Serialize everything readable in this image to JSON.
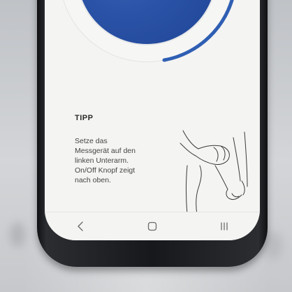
{
  "tip": {
    "title": "TIPP",
    "text": "Setze das\nMessgerät auf den\nlinken Unterarm.\nOn/Off Knopf zeigt\nnach oben."
  },
  "gauge": {
    "icon": "blood-pressure-gauge"
  },
  "navbar": {
    "back_icon": "back-chevron-icon",
    "home_icon": "home-icon",
    "recent_icon": "recent-apps-icon",
    "back_glyph": "<",
    "home_glyph": "○",
    "recent_glyph": "|||"
  },
  "colors": {
    "accent_blue": "#2f5fb3",
    "text_dark": "#2a2a2a"
  }
}
